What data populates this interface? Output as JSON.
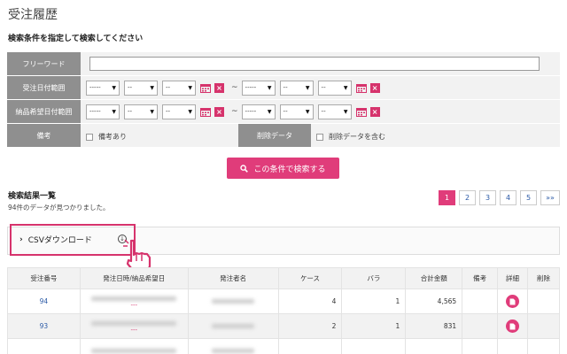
{
  "page": {
    "title": "受注履歴",
    "condition_title": "検索条件を指定して検索してください"
  },
  "search": {
    "free_word_label": "フリーワード",
    "order_date_label": "受注日付範囲",
    "delivery_date_label": "納品希望日付範囲",
    "remarks_label": "備考",
    "remarks_option": "備考あり",
    "deleted_label": "削除データ",
    "deleted_option": "削除データを含む",
    "year_placeholder": "-----",
    "md_placeholder": "--",
    "tilde": "~",
    "clear": "×",
    "button_label": "この条件で検索する"
  },
  "results": {
    "title": "検索結果一覧",
    "count_text": "94件のデータが見つかりました。",
    "pager": [
      "1",
      "2",
      "3",
      "4",
      "5",
      "»»"
    ],
    "csv_label": "CSVダウンロード",
    "columns": [
      "受注番号",
      "発注日時/納品希望日",
      "発注者名",
      "ケース",
      "バラ",
      "合計金額",
      "備考",
      "詳細",
      "削除"
    ],
    "rows": [
      {
        "id": "94",
        "date_dash": "---",
        "cases": "4",
        "bara": "1",
        "total": "4,565"
      },
      {
        "id": "93",
        "date_dash": "---",
        "cases": "2",
        "bara": "1",
        "total": "831"
      }
    ]
  },
  "colors": {
    "accent": "#e03c7a",
    "label_bg": "#8f8f8f",
    "link": "#2b5aa6"
  }
}
